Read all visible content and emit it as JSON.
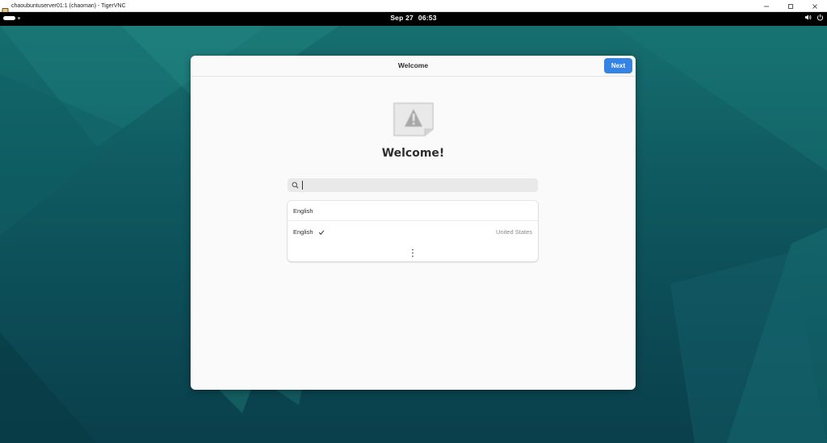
{
  "window": {
    "title": "chaoubuntuserver01:1 (chaoman) - TigerVNC",
    "app_icon": "tigervnc-icon",
    "controls": [
      "minimize-icon",
      "maximize-icon",
      "close-icon"
    ]
  },
  "topbar": {
    "date": "Sep 27",
    "time": "06:53",
    "tray_icons": [
      "volume-icon",
      "power-icon"
    ]
  },
  "dialog": {
    "title": "Welcome",
    "next_label": "Next",
    "heading": "Welcome!",
    "icon": "warning-icon",
    "search": {
      "value": "",
      "placeholder": ""
    },
    "languages": [
      {
        "name": "English",
        "region": "",
        "selected": false
      },
      {
        "name": "English",
        "region": "United States",
        "selected": true
      }
    ],
    "more_icon": "more-vertical-icon"
  },
  "colors": {
    "accent": "#3584e4",
    "dialog_bg": "#fafafa",
    "topbar_bg": "#000000",
    "desktop": "#0f5a60"
  }
}
